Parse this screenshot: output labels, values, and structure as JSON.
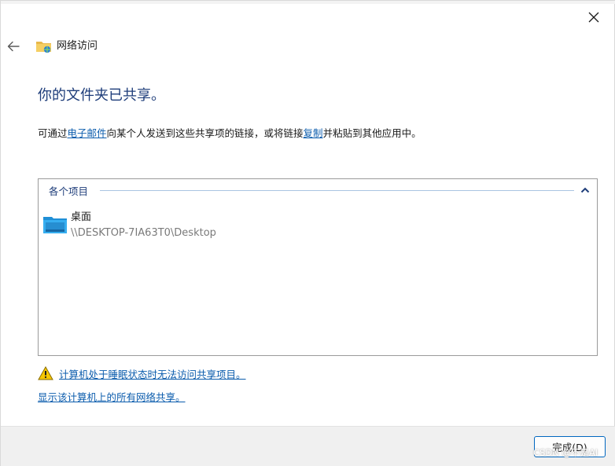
{
  "header": {
    "title": "网络访问"
  },
  "main": {
    "title": "你的文件夹已共享。",
    "description": {
      "part1": "可通过",
      "email_link": "电子邮件",
      "part2": "向某个人发送到这些共享项的链接，或将链接",
      "copy_link": "复制",
      "part3": "并粘贴到其他应用中。"
    }
  },
  "list": {
    "group_label": "各个项目",
    "items": [
      {
        "name": "桌面",
        "path": "\\\\DESKTOP-7IA63T0\\Desktop",
        "icon": "desktop-folder-icon"
      }
    ]
  },
  "links": {
    "sleep_warning": "计算机处于睡眠状态时无法访问共享项目。",
    "show_all_shares": "显示该计算机上的所有网络共享。"
  },
  "footer": {
    "finish_label": "完成(D)"
  },
  "watermark": "CSDN @不是AI",
  "colors": {
    "title_blue": "#1e3d7a",
    "link_blue": "#0b5cad",
    "button_accent": "#0067c0",
    "footer_bg": "#f0f0f0",
    "warning_yellow": "#f7c700"
  },
  "icons": {
    "close": "close-icon",
    "back": "back-arrow-icon",
    "header": "network-folder-icon",
    "collapse": "chevron-up-icon",
    "warning": "warning-icon"
  }
}
